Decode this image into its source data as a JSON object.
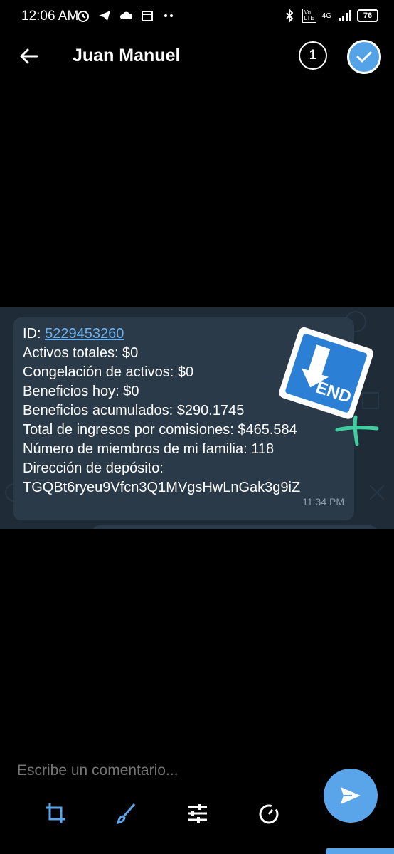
{
  "status": {
    "time": "12:06 AM",
    "left_icons": [
      "alarm-icon",
      "telegram-icon",
      "cloud-icon",
      "calendar-icon",
      "more-dots-icon"
    ],
    "right_icons": [
      "bluetooth-icon",
      "volte-icon",
      "4g-signal-icon",
      "signal-bars-icon"
    ],
    "network": "4G",
    "volte": "Vo LTE",
    "battery": "76"
  },
  "header": {
    "title": "Juan Manuel",
    "selected_count": "1"
  },
  "message": {
    "id_label": "ID: ",
    "id_value": "5229453260",
    "lines": [
      "Activos totales: $0",
      "Congelación de activos: $0",
      "Beneficios hoy: $0",
      "Beneficios acumulados: $290.1745",
      "Total de ingresos por comisiones: $465.584",
      "Número de miembros de mi familia: 118",
      "Dirección de depósito:",
      "TGQBt6ryeu9Vfcn3Q1MVgsHwLnGak3g9iZ"
    ],
    "time": "11:34 PM",
    "sticker_text": "END"
  },
  "composer": {
    "placeholder": "Escribe un comentario..."
  },
  "tools": [
    "crop-icon",
    "brush-icon",
    "adjust-sliders-icon",
    "timer-icon"
  ],
  "colors": {
    "accent": "#5aa5e9",
    "bubble": "#2a3a49",
    "link": "#6ab3f3"
  }
}
